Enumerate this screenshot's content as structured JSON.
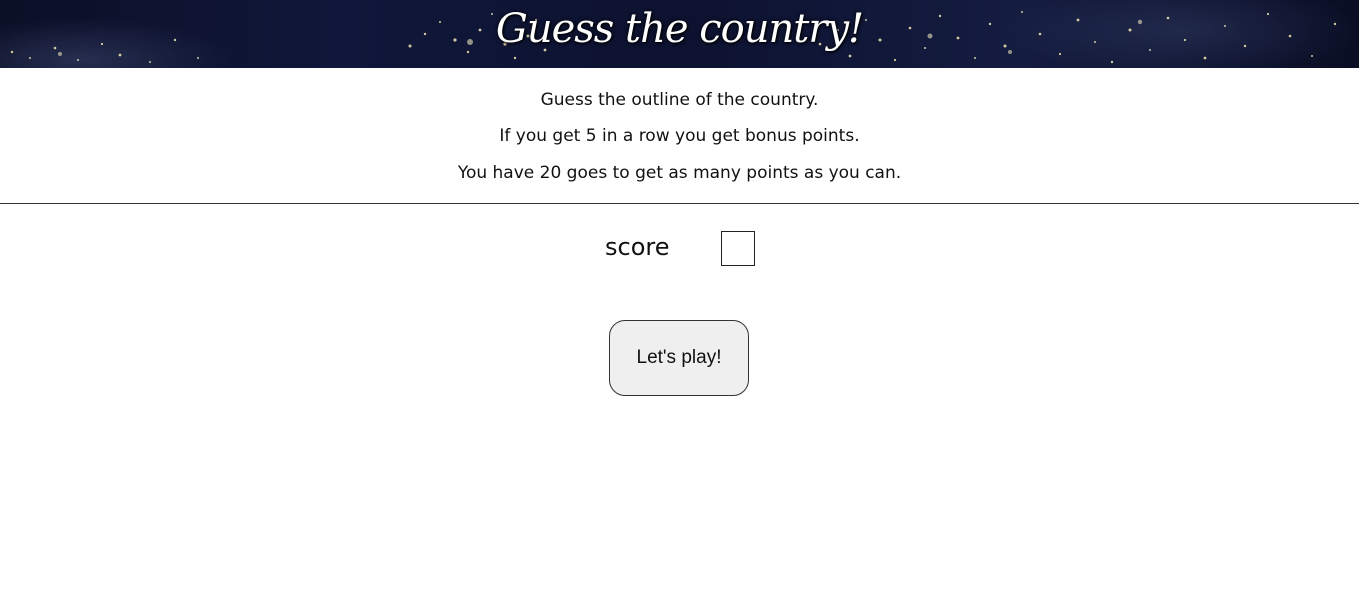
{
  "header": {
    "title": "Guess the country!"
  },
  "intro": {
    "line1": "Guess the outline of the country.",
    "line2": "If you get 5 in a row you get bonus points.",
    "line3": "You have 20 goes to get as many points as you can."
  },
  "score": {
    "label": "score",
    "value": ""
  },
  "actions": {
    "play_label": "Let's play!"
  },
  "colors": {
    "banner_background": "#0d1230",
    "banner_lights": "#f3e9b0",
    "button_background": "#efefef",
    "divider": "#333333"
  }
}
